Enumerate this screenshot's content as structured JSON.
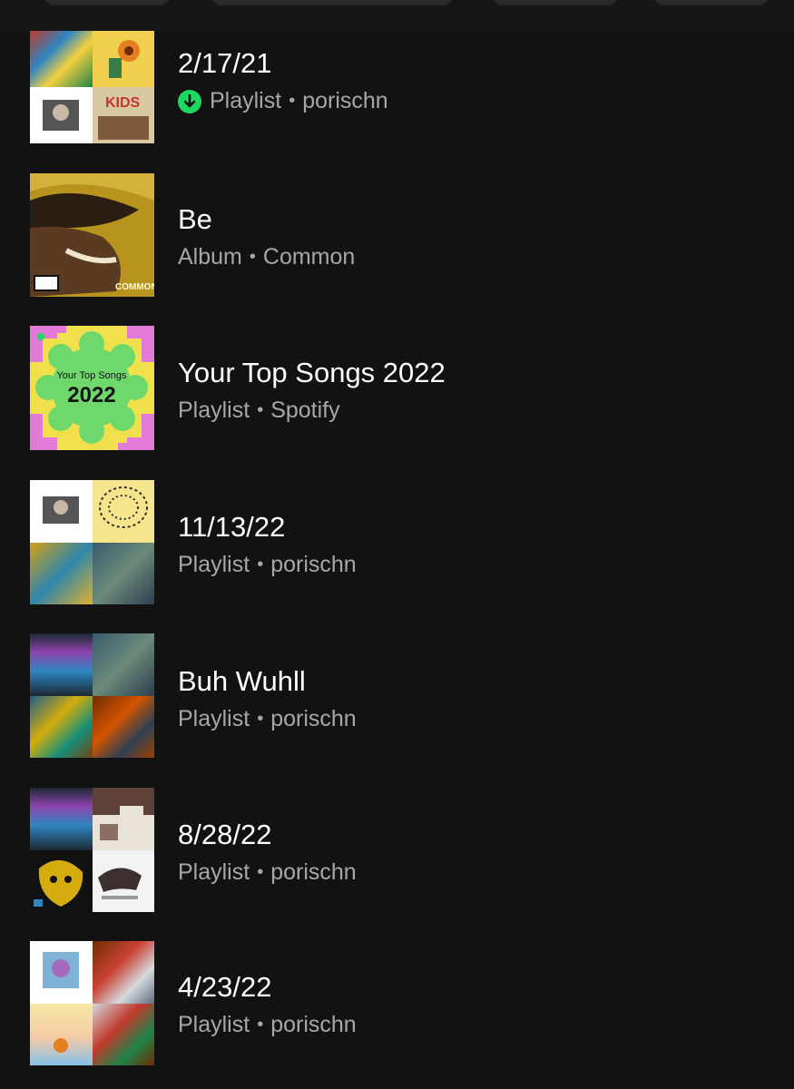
{
  "top_chips": [
    {
      "name": "filter-chip-1"
    },
    {
      "name": "filter-chip-2"
    },
    {
      "name": "filter-chip-3"
    },
    {
      "name": "filter-chip-4"
    }
  ],
  "library_items": [
    {
      "title": "2/17/21",
      "type": "Playlist",
      "owner": "porischn",
      "downloaded": true
    },
    {
      "title": "Be",
      "type": "Album",
      "owner": "Common",
      "downloaded": false
    },
    {
      "title": "Your Top Songs 2022",
      "type": "Playlist",
      "owner": "Spotify",
      "downloaded": false
    },
    {
      "title": "11/13/22",
      "type": "Playlist",
      "owner": "porischn",
      "downloaded": false
    },
    {
      "title": "Buh Wuhll",
      "type": "Playlist",
      "owner": "porischn",
      "downloaded": false
    },
    {
      "title": "8/28/22",
      "type": "Playlist",
      "owner": "porischn",
      "downloaded": false
    },
    {
      "title": "4/23/22",
      "type": "Playlist",
      "owner": "porischn",
      "downloaded": false
    }
  ],
  "separator": "•",
  "cover_art": {
    "top_songs_line1": "Your Top Songs",
    "top_songs_line2": "2022",
    "be_album_label": "COMMON",
    "kids_label": "KIDS"
  },
  "colors": {
    "background": "#121212",
    "subtext": "#a7a7a7",
    "accent_green": "#1ed760"
  }
}
